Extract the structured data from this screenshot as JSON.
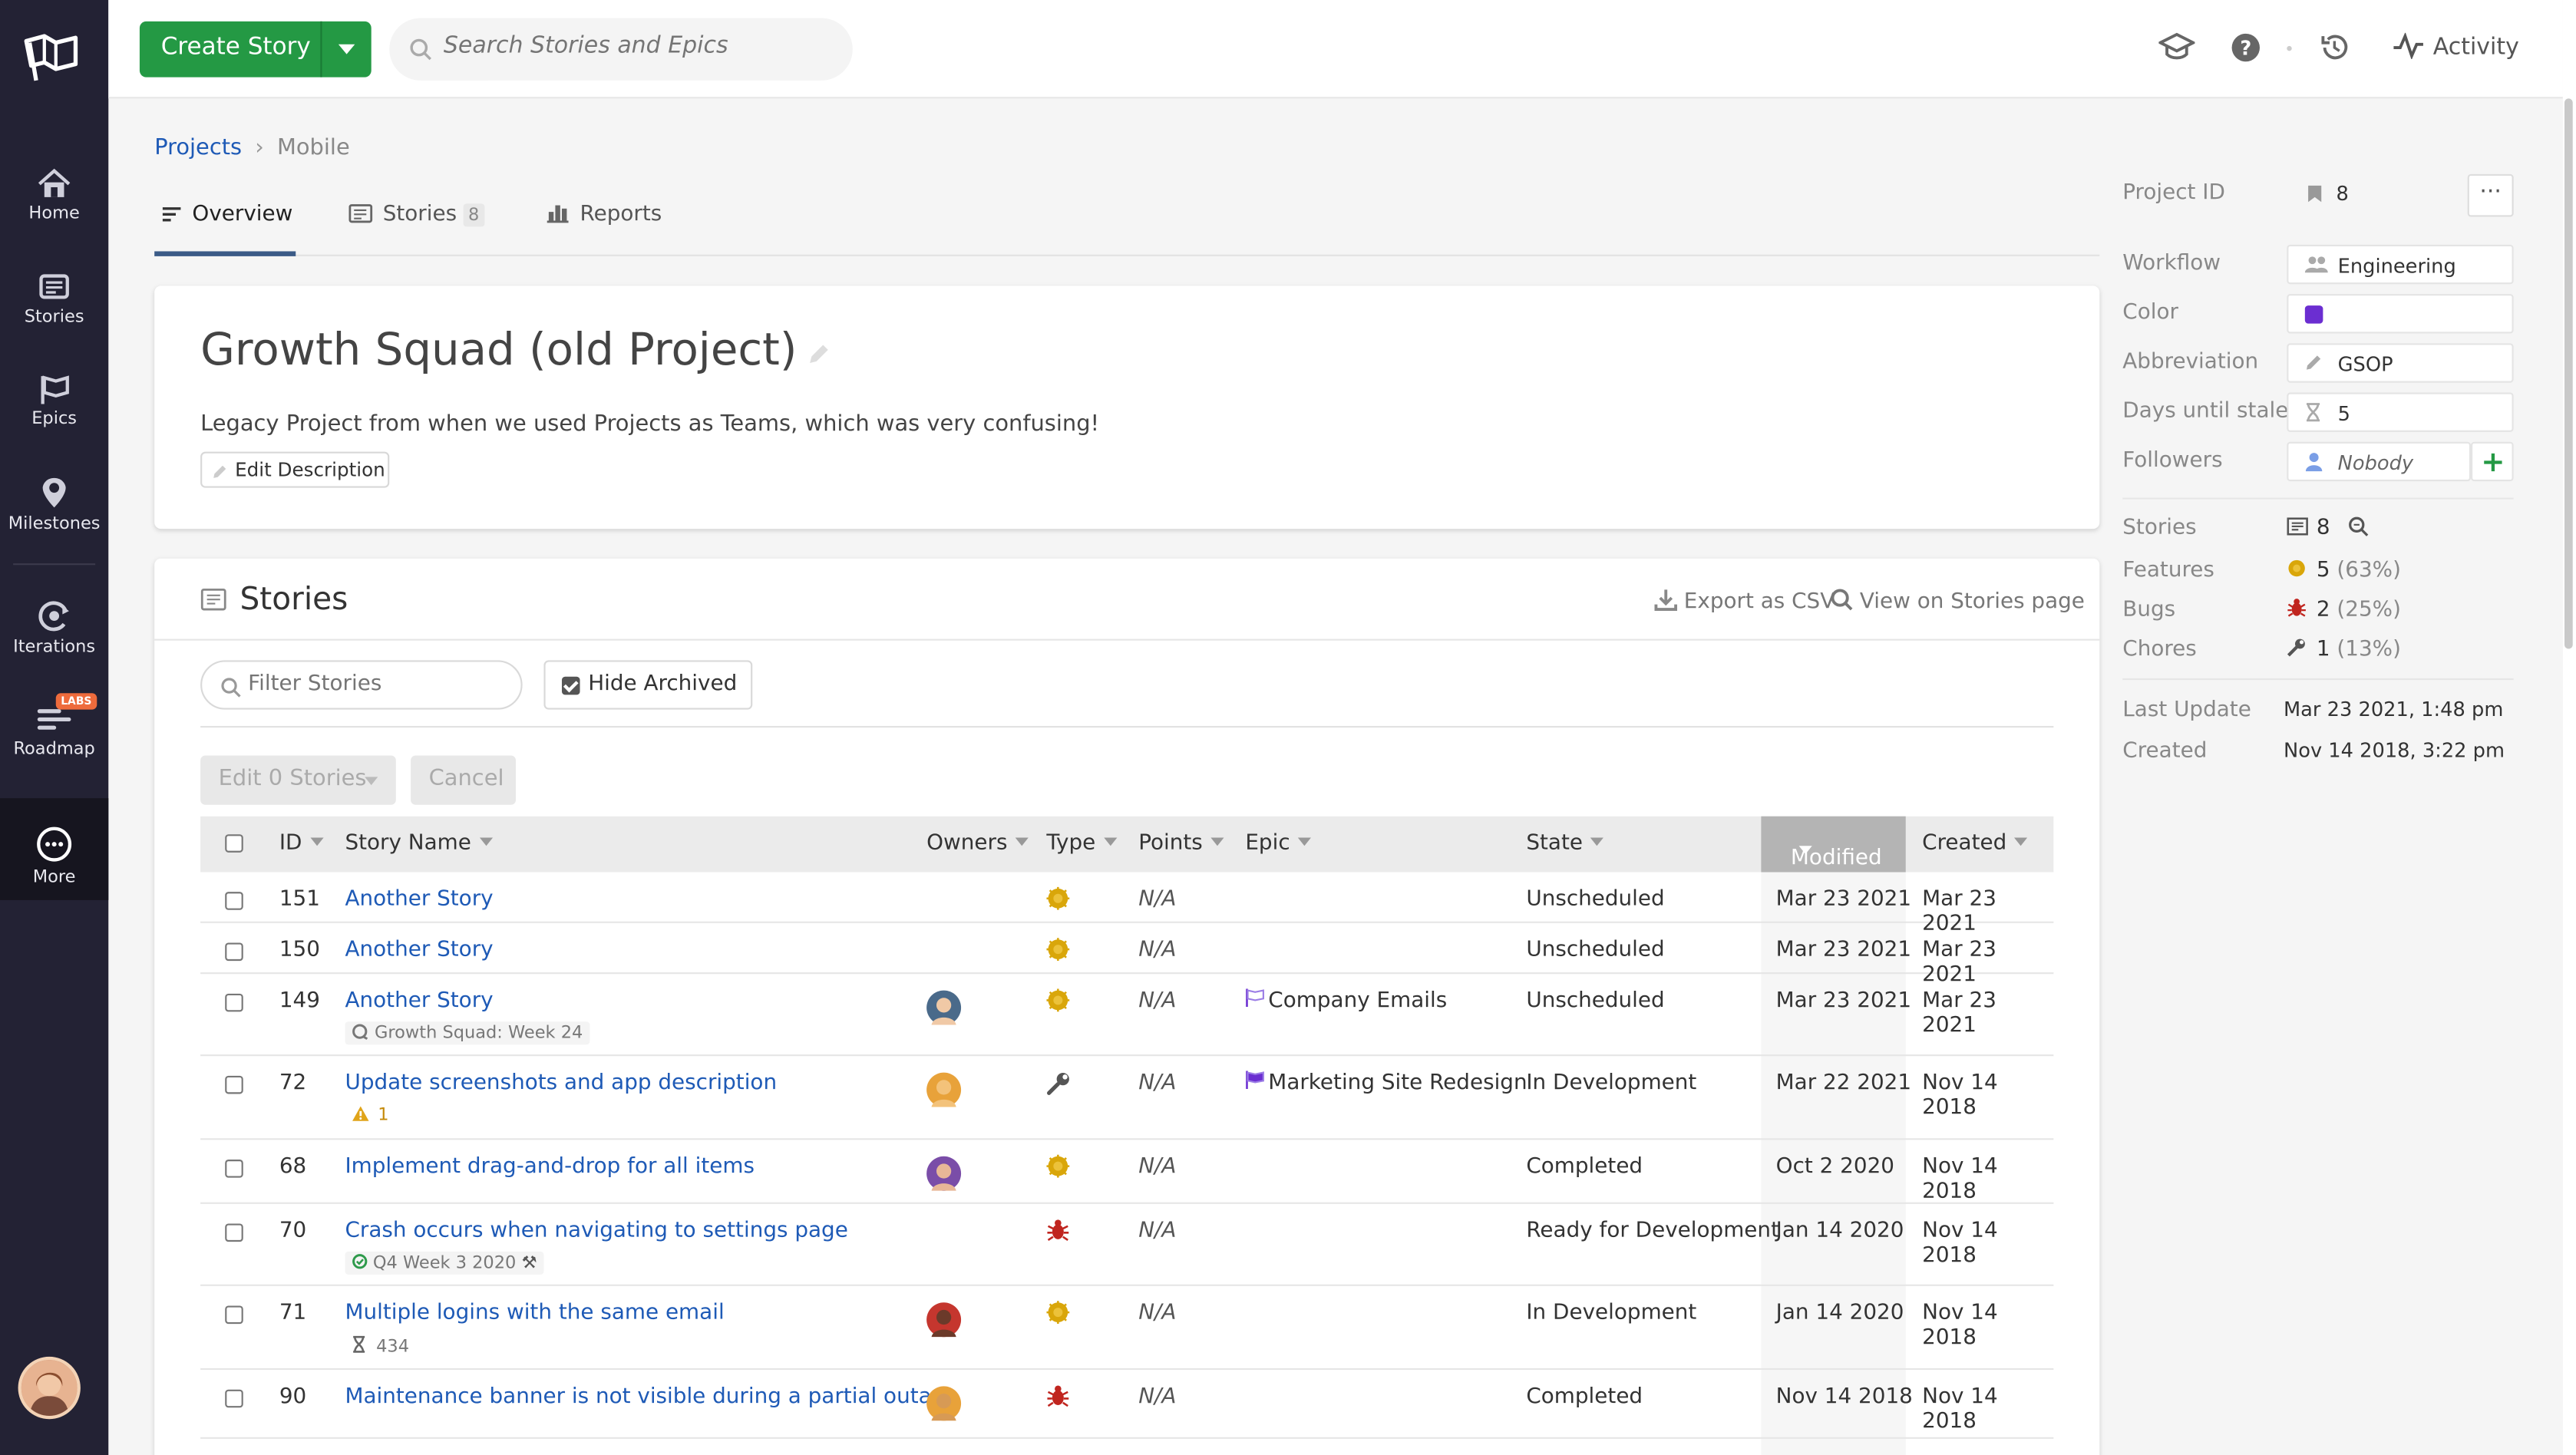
{
  "sidebar": {
    "items": [
      {
        "label": "Home",
        "icon": "home-icon"
      },
      {
        "label": "Stories",
        "icon": "stories-icon"
      },
      {
        "label": "Epics",
        "icon": "epics-icon"
      },
      {
        "label": "Milestones",
        "icon": "milestones-icon"
      },
      {
        "label": "Iterations",
        "icon": "iterations-icon"
      },
      {
        "label": "Roadmap",
        "icon": "roadmap-icon",
        "badge": "LABS"
      },
      {
        "label": "More",
        "icon": "more-icon"
      }
    ]
  },
  "topbar": {
    "create_label": "Create Story",
    "search_placeholder": "Search Stories and Epics",
    "activity_label": "Activity"
  },
  "breadcrumb": {
    "root": "Projects",
    "current": "Mobile"
  },
  "tabs": {
    "overview": "Overview",
    "stories": "Stories",
    "stories_count": "8",
    "reports": "Reports"
  },
  "project": {
    "title": "Growth Squad (old Project)",
    "description": "Legacy Project from when we used Projects as Teams, which was very confusing!",
    "edit_description": "Edit Description"
  },
  "stories_section": {
    "title": "Stories",
    "export_csv": "Export as CSV",
    "view_on_stories": "View on Stories page",
    "filter_placeholder": "Filter Stories",
    "hide_archived": "Hide Archived",
    "edit_button": "Edit 0 Stories",
    "cancel_button": "Cancel",
    "columns": {
      "id": "ID",
      "name": "Story Name",
      "owners": "Owners",
      "type": "Type",
      "points": "Points",
      "epic": "Epic",
      "state": "State",
      "modified": "Modified",
      "created": "Created"
    },
    "rows": [
      {
        "id": "151",
        "name": "Another Story",
        "type": "feature",
        "points": "N/A",
        "epic": "",
        "state": "Unscheduled",
        "modified": "Mar 23 2021",
        "created": "Mar 23 2021",
        "sub": ""
      },
      {
        "id": "150",
        "name": "Another Story",
        "type": "feature",
        "points": "N/A",
        "epic": "",
        "state": "Unscheduled",
        "modified": "Mar 23 2021",
        "created": "Mar 23 2021",
        "sub": ""
      },
      {
        "id": "149",
        "name": "Another Story",
        "type": "feature",
        "points": "N/A",
        "epic": "Company Emails",
        "state": "Unscheduled",
        "modified": "Mar 23 2021",
        "created": "Mar 23 2021",
        "sub": "Growth Squad: Week 24"
      },
      {
        "id": "72",
        "name": "Update screenshots and app description",
        "type": "chore",
        "points": "N/A",
        "epic": "Marketing Site Redesign",
        "state": "In Development",
        "modified": "Mar 22 2021",
        "created": "Nov 14 2018",
        "sub": "1"
      },
      {
        "id": "68",
        "name": "Implement drag-and-drop for all items",
        "type": "feature",
        "points": "N/A",
        "epic": "",
        "state": "Completed",
        "modified": "Oct 2 2020",
        "created": "Nov 14 2018",
        "sub": ""
      },
      {
        "id": "70",
        "name": "Crash occurs when navigating to settings page",
        "type": "bug",
        "points": "N/A",
        "epic": "",
        "state": "Ready for Development",
        "modified": "Jan 14 2020",
        "created": "Nov 14 2018",
        "sub": "Q4 Week 3 2020"
      },
      {
        "id": "71",
        "name": "Multiple logins with the same email",
        "type": "feature",
        "points": "N/A",
        "epic": "",
        "state": "In Development",
        "modified": "Jan 14 2020",
        "created": "Nov 14 2018",
        "sub": "434"
      },
      {
        "id": "90",
        "name": "Maintenance banner is not visible during a partial outage",
        "type": "bug",
        "points": "N/A",
        "epic": "",
        "state": "Completed",
        "modified": "Nov 14 2018",
        "created": "Nov 14 2018",
        "sub": ""
      }
    ]
  },
  "details": {
    "project_id_label": "Project ID",
    "project_id": "8",
    "workflow_label": "Workflow",
    "workflow": "Engineering",
    "color_label": "Color",
    "color": "#6b2ed1",
    "abbreviation_label": "Abbreviation",
    "abbreviation": "GSOP",
    "stale_label": "Days until stale",
    "stale": "5",
    "followers_label": "Followers",
    "followers": "Nobody",
    "stories_label": "Stories",
    "stories": "8",
    "features_label": "Features",
    "features": "5",
    "features_pct": "(63%)",
    "bugs_label": "Bugs",
    "bugs": "2",
    "bugs_pct": "(25%)",
    "chores_label": "Chores",
    "chores": "1",
    "chores_pct": "(13%)",
    "last_update_label": "Last Update",
    "last_update": "Mar 23 2021, 1:48 pm",
    "created_label": "Created",
    "created": "Nov 14 2018, 3:22 pm"
  },
  "colors": {
    "accent": "#249944",
    "link": "#1e5ab6",
    "sidebar": "#232234",
    "feature": "#d9a60a",
    "bug": "#c0251f"
  }
}
